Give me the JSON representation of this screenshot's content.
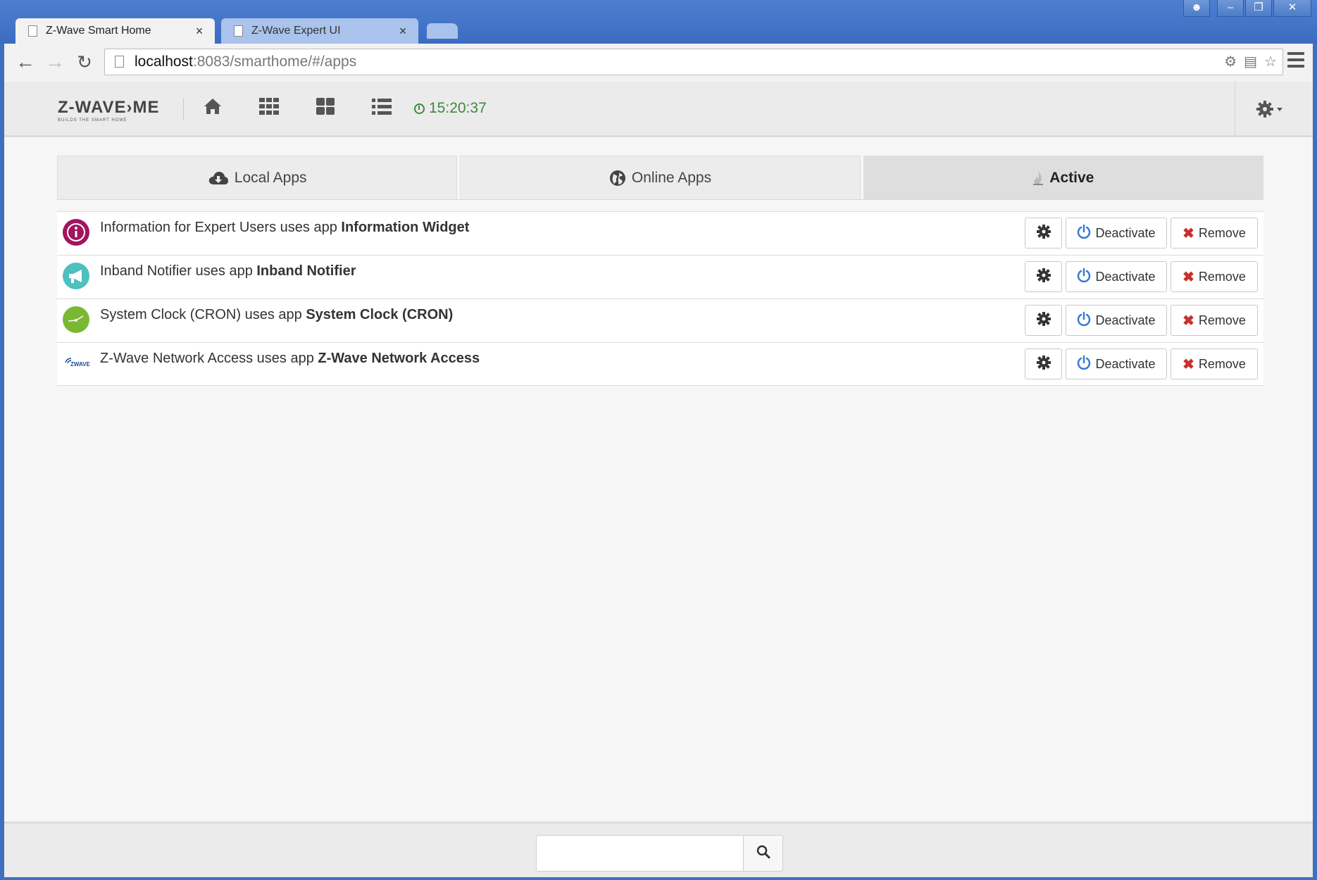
{
  "browser": {
    "tabs": [
      {
        "title": "Z-Wave Smart Home",
        "close": "×"
      },
      {
        "title": "Z-Wave Expert UI",
        "close": "×"
      }
    ],
    "url_host": "localhost",
    "url_rest": ":8083/smarthome/#/apps"
  },
  "header": {
    "logo": "Z-WAVE›ME",
    "logo_tagline": "BUILDS THE SMART HOME",
    "time": "15:20:37"
  },
  "apps_tabs": [
    {
      "label": "Local Apps",
      "icon": "cloud-download-icon"
    },
    {
      "label": "Online Apps",
      "icon": "globe-icon"
    },
    {
      "label": "Active",
      "icon": "fire-icon",
      "selected": true
    }
  ],
  "apps": [
    {
      "instance": "Information for Expert Users",
      "connector": "uses app",
      "app": "Information Widget",
      "icon_color": "#a1145e"
    },
    {
      "instance": "Inband Notifier",
      "connector": "uses app",
      "app": "Inband Notifier",
      "icon_color": "#4fbfbf"
    },
    {
      "instance": "System Clock (CRON)",
      "connector": "uses app",
      "app": "System Clock (CRON)",
      "icon_color": "#7ab833"
    },
    {
      "instance": "Z-Wave Network Access",
      "connector": "uses app",
      "app": "Z-Wave Network Access",
      "icon_color": "#1b4a9a"
    }
  ],
  "actions": {
    "deactivate": "Deactivate",
    "remove": "Remove"
  },
  "footer": {
    "search_placeholder": ""
  }
}
